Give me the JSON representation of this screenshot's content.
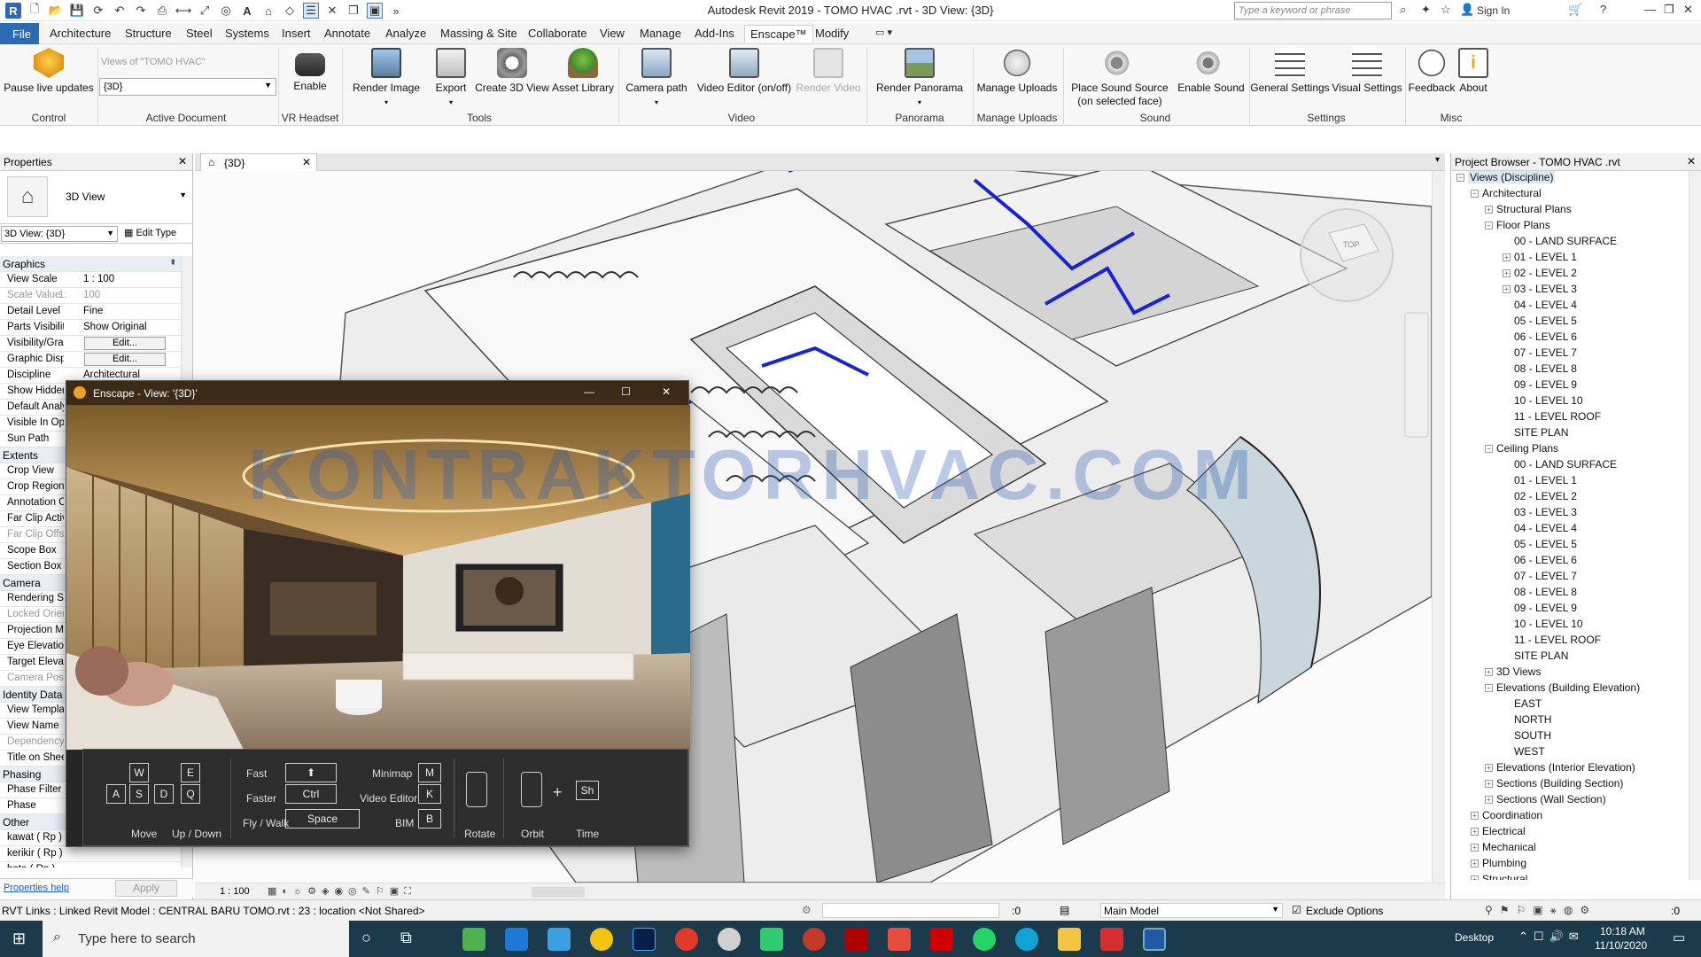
{
  "titlebar": {
    "title": "Autodesk Revit 2019 -  TOMO HVAC .rvt - 3D View: {3D}",
    "search_placeholder": "Type a keyword or phrase",
    "sign_in": "Sign In"
  },
  "menu": {
    "tabs": [
      "File",
      "Architecture",
      "Structure",
      "Steel",
      "Systems",
      "Insert",
      "Annotate",
      "Analyze",
      "Massing & Site",
      "Collaborate",
      "View",
      "Manage",
      "Add-Ins",
      "Enscape™",
      "Modify"
    ]
  },
  "ribbon": {
    "pause_live_updates": "Pause live updates",
    "active_document_label": "Views of \"TOMO HVAC\"",
    "active_document_value": "{3D}",
    "enable": "Enable",
    "render_image": "Render Image",
    "export": "Export",
    "create_3d_view": "Create 3D View",
    "asset_library": "Asset Library",
    "camera_path": "Camera path",
    "video_editor": "Video Editor (on/off)",
    "render_video": "Render Video",
    "render_panorama": "Render Panorama",
    "manage_uploads": "Manage Uploads",
    "place_sound_source": "Place Sound Source",
    "place_sound_source_sub": "(on selected face)",
    "enable_sound": "Enable Sound",
    "general_settings": "General Settings",
    "visual_settings": "Visual Settings",
    "feedback": "Feedback",
    "about": "About",
    "groups": {
      "control": "Control",
      "active_document": "Active Document",
      "vr_headset": "VR Headset",
      "tools": "Tools",
      "video": "Video",
      "panorama": "Panorama",
      "manage_uploads": "Manage Uploads",
      "sound": "Sound",
      "settings": "Settings",
      "misc": "Misc"
    }
  },
  "properties": {
    "title": "Properties",
    "type_name": "3D View",
    "instance_selector": "3D View: {3D}",
    "edit_type": "Edit Type",
    "help_link": "Properties help",
    "apply": "Apply",
    "rows": [
      {
        "k": "Graphics",
        "cat": true
      },
      {
        "k": "View Scale",
        "v": "1 : 100"
      },
      {
        "k": "Scale Value",
        "v": "100",
        "dim": true,
        "pre": "1:"
      },
      {
        "k": "Detail Level",
        "v": "Fine"
      },
      {
        "k": "Parts Visibility",
        "v": "Show Original"
      },
      {
        "k": "Visibility/Grap...",
        "v": "Edit...",
        "btn": true
      },
      {
        "k": "Graphic Displ...",
        "v": "Edit...",
        "btn": true
      },
      {
        "k": "Discipline",
        "v": "Architectural"
      },
      {
        "k": "Show Hidden Lines"
      },
      {
        "k": "Default Analysis"
      },
      {
        "k": "Visible In Option"
      },
      {
        "k": "Sun Path"
      },
      {
        "k": "Extents",
        "cat": true
      },
      {
        "k": "Crop View"
      },
      {
        "k": "Crop Region Visible"
      },
      {
        "k": "Annotation Crop"
      },
      {
        "k": "Far Clip Active"
      },
      {
        "k": "Far Clip Offset",
        "dim": true
      },
      {
        "k": "Scope Box"
      },
      {
        "k": "Section Box"
      },
      {
        "k": "Camera",
        "cat": true
      },
      {
        "k": "Rendering Settings"
      },
      {
        "k": "Locked Orientation",
        "dim": true
      },
      {
        "k": "Projection Mode"
      },
      {
        "k": "Eye Elevation"
      },
      {
        "k": "Target Elevation"
      },
      {
        "k": "Camera Position",
        "dim": true
      },
      {
        "k": "Identity Data",
        "cat": true
      },
      {
        "k": "View Template"
      },
      {
        "k": "View Name"
      },
      {
        "k": "Dependency",
        "dim": true
      },
      {
        "k": "Title on Sheet"
      },
      {
        "k": "Phasing",
        "cat": true
      },
      {
        "k": "Phase Filter"
      },
      {
        "k": "Phase"
      },
      {
        "k": "Other",
        "cat": true
      },
      {
        "k": "kawat ( Rp )"
      },
      {
        "k": "kerikir ( Rp )"
      },
      {
        "k": "bata ( Rp )"
      }
    ]
  },
  "view": {
    "tab_label": "{3D}",
    "scale": "1 : 100",
    "viewcube_top": "TOP"
  },
  "enscape": {
    "title": "Enscape - View: '{3D}'",
    "keys": {
      "w": "W",
      "a": "A",
      "s": "S",
      "d": "D",
      "e": "E",
      "q": "Q",
      "fast_key": "⬆",
      "faster_key": "Ctrl",
      "fly_key": "Space",
      "minimap_key": "M",
      "video_key": "K",
      "bim_key": "B",
      "sh_key": "Sh"
    },
    "labels": {
      "move": "Move",
      "updown": "Up / Down",
      "fast": "Fast",
      "faster": "Faster",
      "fly": "Fly / Walk",
      "minimap": "Minimap",
      "video": "Video Editor",
      "bim": "BIM",
      "rotate": "Rotate",
      "orbit": "Orbit",
      "time": "Time"
    }
  },
  "watermark": "KONTRAKTORHVAC.COM",
  "browser": {
    "title": "Project Browser - TOMO HVAC .rvt",
    "root": "Views (Discipline)",
    "architectural": "Architectural",
    "structural_plans": "Structural Plans",
    "floor_plans": "Floor Plans",
    "floor_levels": [
      "00 - LAND SURFACE",
      "01 - LEVEL 1",
      "02 - LEVEL 2",
      "03 - LEVEL 3",
      "04 - LEVEL 4",
      "05 - LEVEL 5",
      "06 - LEVEL 6",
      "07 - LEVEL 7",
      "08 - LEVEL 8",
      "09 - LEVEL 9",
      "10 - LEVEL 10",
      "11 - LEVEL ROOF",
      "SITE PLAN"
    ],
    "ceiling_plans": "Ceiling Plans",
    "ceiling_levels": [
      "00 - LAND SURFACE",
      "01 - LEVEL 1",
      "02 - LEVEL 2",
      "03 - LEVEL 3",
      "04 - LEVEL 4",
      "05 - LEVEL 5",
      "06 - LEVEL 6",
      "07 - LEVEL 7",
      "08 - LEVEL 8",
      "09 - LEVEL 9",
      "10 - LEVEL 10",
      "11 - LEVEL ROOF",
      "SITE PLAN"
    ],
    "views_3d": "3D Views",
    "elevations_building": "Elevations (Building Elevation)",
    "elevations": [
      "EAST",
      "NORTH",
      "SOUTH",
      "WEST"
    ],
    "elevations_interior": "Elevations (Interior Elevation)",
    "sections_building": "Sections (Building Section)",
    "sections_wall": "Sections (Wall Section)",
    "disciplines": [
      "Coordination",
      "Electrical",
      "Mechanical",
      "Plumbing",
      "Structural"
    ]
  },
  "status": {
    "text": "RVT Links : Linked Revit Model : CENTRAL BARU TOMO.rvt : 23 : location <Not Shared>",
    "zero": ":0",
    "model": "Main Model",
    "exclude_options": "Exclude Options",
    "filter_count": ":0"
  },
  "taskbar": {
    "search": "Type here to search",
    "desktop": "Desktop",
    "time": "10:18 AM",
    "date": "11/10/2020"
  }
}
